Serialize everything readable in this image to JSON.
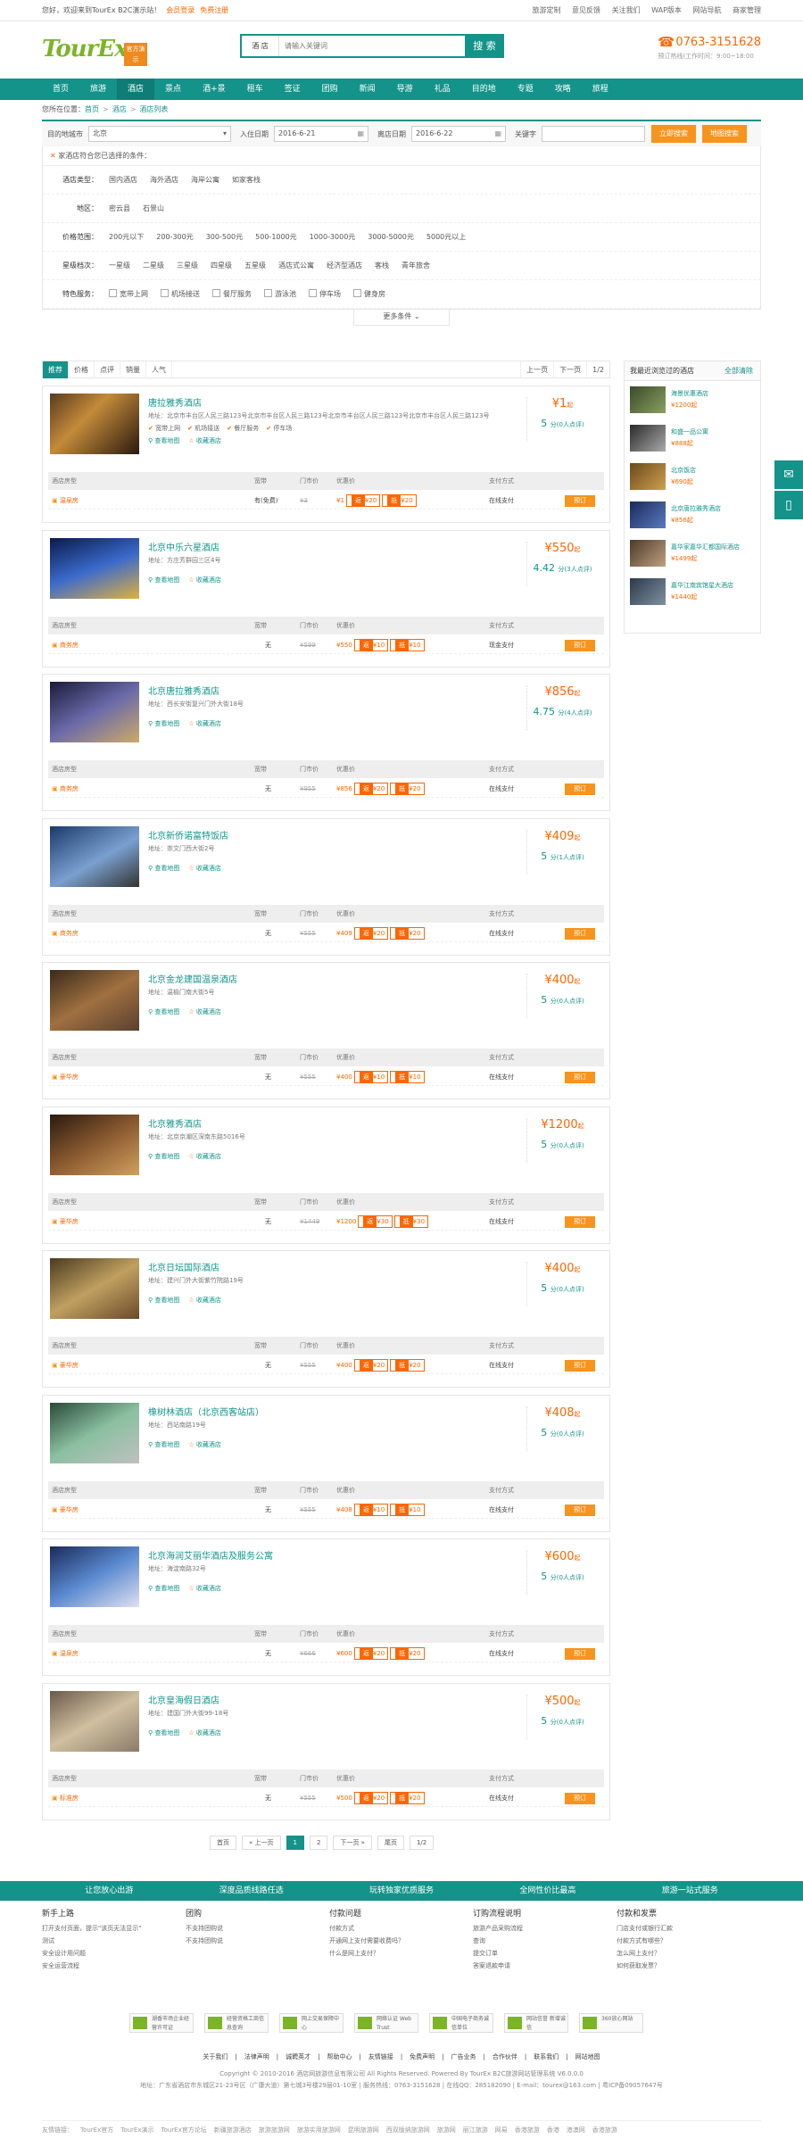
{
  "topbar": {
    "welcome": "您好，欢迎来到TourEx B2C演示站！",
    "login": "会员登录",
    "register": "免费注册",
    "links": [
      "旅游定制",
      "意见反馈",
      "关注我们",
      "WAP版本",
      "网站导航",
      "商家管理"
    ]
  },
  "logo": {
    "text": "TourEx",
    "badge": "官方演示"
  },
  "search": {
    "category": "酒 店",
    "placeholder": "请输入关键词",
    "button": "搜 索"
  },
  "phone": {
    "number": "0763-3151628",
    "hours": "预订热线(工作时间：9:00~18:00"
  },
  "nav": [
    "首页",
    "旅游",
    "酒店",
    "景点",
    "酒+景",
    "租车",
    "签证",
    "团购",
    "新闻",
    "导游",
    "礼品",
    "目的地",
    "专题",
    "攻略",
    "旅程"
  ],
  "crumb": {
    "label": "您所在位置：",
    "items": [
      "首页",
      "酒店",
      "酒店列表"
    ]
  },
  "filter": {
    "city_label": "目的地城市",
    "city": "北京",
    "checkin_label": "入住日期",
    "checkin": "2016-6-21",
    "checkout_label": "离店日期",
    "checkout": "2016-6-22",
    "kw_label": "关键字",
    "search_btn": "立即搜索",
    "map_btn": "地图搜索"
  },
  "conds": {
    "selected": "家酒店符合您已选择的条件：",
    "selected_icon": "✕",
    "rows": [
      {
        "k": "酒店类型：",
        "v": [
          "国内酒店",
          "海外酒店",
          "海岸公寓",
          "如家客栈"
        ]
      },
      {
        "k": "地区：",
        "v": [
          "密云县",
          "石景山"
        ]
      },
      {
        "k": "价格范围：",
        "v": [
          "200元以下",
          "200-300元",
          "300-500元",
          "500-1000元",
          "1000-3000元",
          "3000-5000元",
          "5000元以上"
        ]
      },
      {
        "k": "星级档次：",
        "v": [
          "一星级",
          "二星级",
          "三星级",
          "四星级",
          "五星级",
          "酒店式公寓",
          "经济型酒店",
          "客栈",
          "青年旅舍"
        ]
      },
      {
        "k": "特色服务：",
        "v": [
          "宽带上网",
          "机场接送",
          "餐厅服务",
          "游泳池",
          "停车场",
          "健身房"
        ],
        "cb": true
      }
    ],
    "more": "更多条件 ⌄"
  },
  "sort": {
    "items": [
      "推荐",
      "价格",
      "点评",
      "销量",
      "人气"
    ],
    "prev": "上一页",
    "next": "下一页",
    "page": "1/2"
  },
  "table_head": {
    "room": "酒店房型",
    "bed": "宽带",
    "front": "门市价",
    "disc": "优惠价",
    "pay": "支付方式"
  },
  "hotels": [
    {
      "name": "唐拉雅秀酒店",
      "addr": "地址：北京市丰台区人民三路123号北京市丰台区人民三路123号北京市丰台区人民三路123号北京市丰台区人民三路123号",
      "tags": [
        "宽带上网",
        "机场接送",
        "餐厅服务",
        "停车场"
      ],
      "price": "¥1",
      "score": "5",
      "score_note": "分(0人点评)",
      "room": "温泉房",
      "bed": "有(免费)",
      "front": "¥3",
      "disc": "¥1",
      "b1": "¥20",
      "b2": "¥20",
      "pay": "在线支付",
      "book": "预订"
    },
    {
      "name": "北京中乐六星酒店",
      "addr": "地址：方庄芳群园三区4号",
      "tags": [],
      "price": "¥550",
      "score": "4.42",
      "score_note": "分(3人点评)",
      "room": "商务房",
      "bed": "无",
      "front": "¥599",
      "disc": "¥550",
      "b1": "¥10",
      "b2": "¥10",
      "pay": "现金支付",
      "book": "预订"
    },
    {
      "name": "北京唐拉雅秀酒店",
      "addr": "地址：西长安街复兴门外大街18号",
      "tags": [],
      "price": "¥856",
      "score": "4.75",
      "score_note": "分(4人点评)",
      "room": "商务房",
      "bed": "无",
      "front": "¥955",
      "disc": "¥856",
      "b1": "¥20",
      "b2": "¥20",
      "pay": "在线支付",
      "book": "预订"
    },
    {
      "name": "北京新侨诺富特饭店",
      "addr": "地址：崇文门西大街2号",
      "tags": [],
      "price": "¥409",
      "score": "5",
      "score_note": "分(1人点评)",
      "room": "商务房",
      "bed": "无",
      "front": "¥555",
      "disc": "¥409",
      "b1": "¥20",
      "b2": "¥20",
      "pay": "在线支付",
      "book": "预订"
    },
    {
      "name": "北京金龙建国温泉酒店",
      "addr": "地址：温榆门南大街5号",
      "tags": [],
      "price": "¥400",
      "score": "5",
      "score_note": "分(0人点评)",
      "room": "豪华房",
      "bed": "无",
      "front": "¥555",
      "disc": "¥400",
      "b1": "¥10",
      "b2": "¥10",
      "pay": "在线支付",
      "book": "预订"
    },
    {
      "name": "北京雅秀酒店",
      "addr": "地址：北京京潮区深南东路5016号",
      "tags": [],
      "price": "¥1200",
      "score": "5",
      "score_note": "分(0人点评)",
      "room": "豪华房",
      "bed": "无",
      "front": "¥1449",
      "disc": "¥1200",
      "b1": "¥30",
      "b2": "¥30",
      "pay": "在线支付",
      "book": "预订"
    },
    {
      "name": "北京日坛国际酒店",
      "addr": "地址：建兴门外大街紫竹院路19号",
      "tags": [],
      "price": "¥400",
      "score": "5",
      "score_note": "分(0人点评)",
      "room": "豪华房",
      "bed": "无",
      "front": "¥555",
      "disc": "¥400",
      "b1": "¥20",
      "b2": "¥20",
      "pay": "在线支付",
      "book": "预订"
    },
    {
      "name": "橡树林酒店（北京西客站店）",
      "addr": "地址：西站南路19号",
      "tags": [],
      "price": "¥408",
      "score": "5",
      "score_note": "分(0人点评)",
      "room": "豪华房",
      "bed": "无",
      "front": "¥555",
      "disc": "¥408",
      "b1": "¥10",
      "b2": "¥10",
      "pay": "在线支付",
      "book": "预订"
    },
    {
      "name": "北京海润艾丽华酒店及服务公寓",
      "addr": "地址：海淀南路32号",
      "tags": [],
      "price": "¥600",
      "score": "5",
      "score_note": "分(0人点评)",
      "room": "温泉房",
      "bed": "无",
      "front": "¥666",
      "disc": "¥600",
      "b1": "¥20",
      "b2": "¥20",
      "pay": "在线支付",
      "book": "预订"
    },
    {
      "name": "北京皇海假日酒店",
      "addr": "地址：建国门外大街99-18号",
      "tags": [],
      "price": "¥500",
      "score": "5",
      "score_note": "分(0人点评)",
      "room": "标准房",
      "bed": "无",
      "front": "¥555",
      "disc": "¥500",
      "b1": "¥20",
      "b2": "¥20",
      "pay": "在线支付",
      "book": "预订"
    }
  ],
  "side": {
    "title": "我最近浏览过的酒店",
    "clear": "全部清除",
    "items": [
      {
        "n": "海景优惠酒店",
        "p": "¥1200起"
      },
      {
        "n": "和盛一品公寓",
        "p": "¥888起"
      },
      {
        "n": "北京饭店",
        "p": "¥690起"
      },
      {
        "n": "北京唐拉雅秀酒店",
        "p": "¥856起"
      },
      {
        "n": "嘉华家嘉华汇都国际酒店",
        "p": "¥1499起"
      },
      {
        "n": "嘉华江南宾馆星大酒店",
        "p": "¥1440起"
      }
    ]
  },
  "pager": [
    "首页",
    "« 上一页",
    "1",
    "2",
    "下一页 »",
    "尾页",
    "1/2"
  ],
  "svc": [
    "让您放心出游",
    "深度品质线路任选",
    "玩转独家优质服务",
    "全网性价比最高",
    "旅游一站式服务"
  ],
  "fcols": [
    {
      "h": "新手上路",
      "l": [
        "打开支付页面，提示\"该页无法显示\"",
        "测试",
        "安全设计用问题",
        "安全运营流程"
      ]
    },
    {
      "h": "团购",
      "l": [
        "不支持团购说",
        "不支持团购说"
      ]
    },
    {
      "h": "付款问题",
      "l": [
        "付款方式",
        "开通网上支付需要收费吗？",
        "什么是网上支付？"
      ]
    },
    {
      "h": "订购流程说明",
      "l": [
        "旅游产品采购流程",
        "查询",
        "提交订单",
        "答案退款申请"
      ]
    },
    {
      "h": "付款和发票",
      "l": [
        "门店支付或银行汇款",
        "付款方式有哪些？",
        "怎么网上支付？",
        "如何获取发票？"
      ]
    }
  ],
  "certs": [
    "湖香市场企业经营许可证",
    "经营资格工商信息查询",
    "网上交易保障中心",
    "网络认证 Web Trust",
    "中国电子商务诚信单位",
    "网站信誉 新增诚信",
    "360放心网站"
  ],
  "flinks": [
    "关于我们",
    "法律声明",
    "诚聘英才",
    "帮助中心",
    "友情链接",
    "免费声明",
    "广告业务",
    "合作伙伴",
    "联系我们",
    "网站地图"
  ],
  "copy": {
    "l1": "Copyright © 2010-2016 酒店网旅游信息有限公司 All Rights Reserved. Powered By TourEx B2C旅游网站管理系统 V6.0.0.0",
    "l2": "地址：广东省酒店市东城区21-23号区（广康大道）第七城3号楼29层01-10室 | 服务热线：0763-3151628 | 在线QQ：285182090 | E-mail：tourex@163.com | 粤ICP备09057647号"
  },
  "friend": {
    "label": "友情链接：",
    "items": [
      "TourEx官方",
      "TourEx演示",
      "TourEx官方论坛",
      "新疆旅游酒店",
      "旅游旅游网",
      "旅游实用旅游网",
      "昆明旅游网",
      "西双版纳旅游网",
      "旅游网",
      "丽江旅游",
      "网易",
      "香港旅游",
      "香港",
      "港澳网",
      "香港旅游"
    ]
  }
}
